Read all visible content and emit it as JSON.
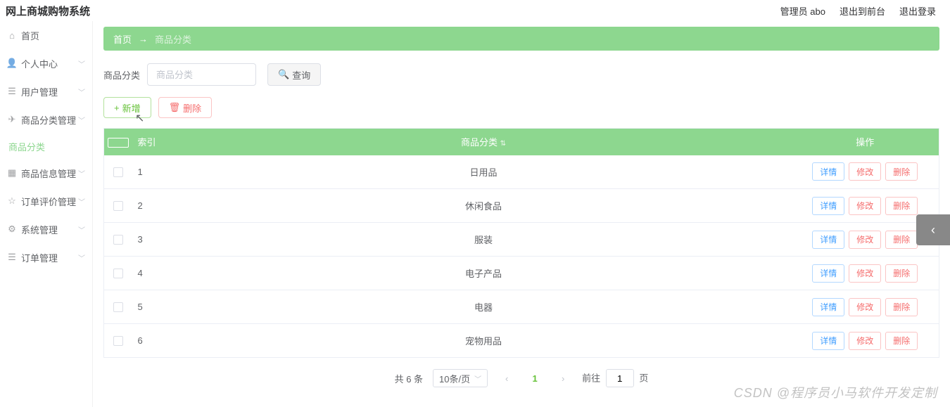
{
  "header": {
    "logo": "网上商城购物系统",
    "admin_label": "管理员 abo",
    "to_front": "退出到前台",
    "logout": "退出登录"
  },
  "sidebar": {
    "items": [
      {
        "icon": "home",
        "label": "首页"
      },
      {
        "icon": "user",
        "label": "个人中心",
        "arrow": true
      },
      {
        "icon": "users",
        "label": "用户管理",
        "arrow": true
      },
      {
        "icon": "send",
        "label": "商品分类管理",
        "arrow": true
      },
      {
        "icon": "grid",
        "label": "商品信息管理",
        "arrow": true
      },
      {
        "icon": "star",
        "label": "订单评价管理",
        "arrow": true
      },
      {
        "icon": "gear",
        "label": "系统管理",
        "arrow": true
      },
      {
        "icon": "list",
        "label": "订单管理",
        "arrow": true
      }
    ],
    "sub_label": "商品分类"
  },
  "breadcrumb": {
    "home": "首页",
    "arrow": "→",
    "current": "商品分类"
  },
  "filter": {
    "label": "商品分类",
    "placeholder": "商品分类",
    "search": "查询"
  },
  "actions": {
    "add": "新增",
    "delete": "删除"
  },
  "table": {
    "headers": {
      "index": "索引",
      "category": "商品分类",
      "ops": "操作"
    },
    "sort_icon": "⇅",
    "rows": [
      {
        "index": "1",
        "category": "日用品"
      },
      {
        "index": "2",
        "category": "休闲食品"
      },
      {
        "index": "3",
        "category": "服装"
      },
      {
        "index": "4",
        "category": "电子产品"
      },
      {
        "index": "5",
        "category": "电器"
      },
      {
        "index": "6",
        "category": "宠物用品"
      }
    ],
    "row_actions": {
      "detail": "详情",
      "edit": "修改",
      "delete": "删除"
    }
  },
  "pagination": {
    "total": "共 6 条",
    "page_size": "10条/页",
    "current": "1",
    "jump_prefix": "前往",
    "jump_value": "1",
    "jump_suffix": "页"
  },
  "watermark": "CSDN @程序员小马软件开发定制"
}
